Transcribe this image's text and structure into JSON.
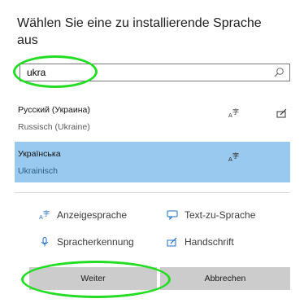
{
  "dialog": {
    "title": "Wählen Sie eine zu installierende Sprache aus"
  },
  "search": {
    "value": "ukra",
    "icon": "search-icon"
  },
  "results": [
    {
      "name": "Русский (Украина)",
      "subtitle": "Russisch (Ukraine)",
      "features": [
        "display-language-icon",
        "handwriting-icon"
      ],
      "selected": false
    },
    {
      "name": "Українська",
      "subtitle": "Ukrainisch",
      "features": [
        "display-language-icon"
      ],
      "selected": true
    }
  ],
  "legend": {
    "display_language": "Anzeigesprache",
    "text_to_speech": "Text-zu-Sprache",
    "speech_recognition": "Spracherkennung",
    "handwriting": "Handschrift"
  },
  "buttons": {
    "next": "Weiter",
    "cancel": "Abbrechen"
  },
  "colors": {
    "selection": "#99c9ef",
    "button": "#cccccc",
    "annotation_ring": "#22dd22",
    "icon_blue": "#1f6fc6"
  }
}
